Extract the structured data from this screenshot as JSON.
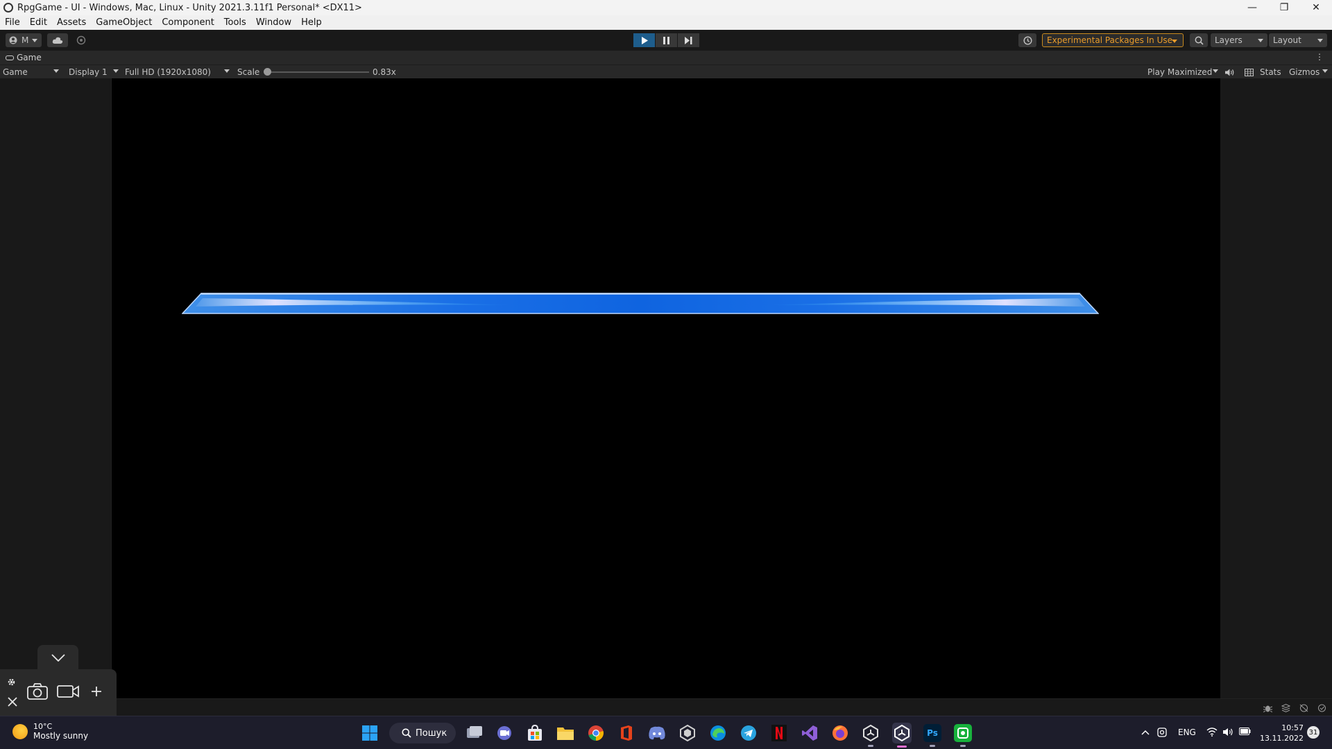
{
  "window": {
    "title": "RpgGame - UI - Windows, Mac, Linux - Unity 2021.3.11f1 Personal* <DX11>"
  },
  "menu": [
    "File",
    "Edit",
    "Assets",
    "GameObject",
    "Component",
    "Tools",
    "Window",
    "Help"
  ],
  "toolbar": {
    "account_label": "M",
    "experimental_label": "Experimental Packages In Use",
    "layers_label": "Layers",
    "layout_label": "Layout",
    "play_state": "playing",
    "accent_color": "#1e5d8c",
    "warning_color": "#e89b2a"
  },
  "tab": {
    "label": "Game"
  },
  "game_view": {
    "mode_label": "Game",
    "display_label": "Display 1",
    "resolution_label": "Full HD (1920x1080)",
    "scale_label": "Scale",
    "scale_value_label": "0.83x",
    "scale_fraction": 0.0,
    "play_mode_label": "Play Maximized",
    "stats_label": "Stats",
    "gizmos_label": "Gizmos"
  },
  "capture_overlay": {
    "icons": [
      "chevron-down-icon",
      "settings-icon",
      "close-icon",
      "camera-icon",
      "video-icon",
      "plus-icon"
    ]
  },
  "taskbar": {
    "weather_temp": "10°C",
    "weather_desc": "Mostly sunny",
    "search_label": "Пошук",
    "language": "ENG",
    "time": "10:57",
    "date": "13.11.2022",
    "notification_count": "31",
    "apps": [
      "windows-start",
      "search",
      "task-view",
      "teams-chat",
      "microsoft-store",
      "file-explorer",
      "chrome",
      "office",
      "discord",
      "unity-hub",
      "edge",
      "telegram",
      "netflix",
      "visual-studio",
      "firefox",
      "unity-hub-2",
      "unity-editor",
      "photoshop",
      "app-green"
    ]
  }
}
